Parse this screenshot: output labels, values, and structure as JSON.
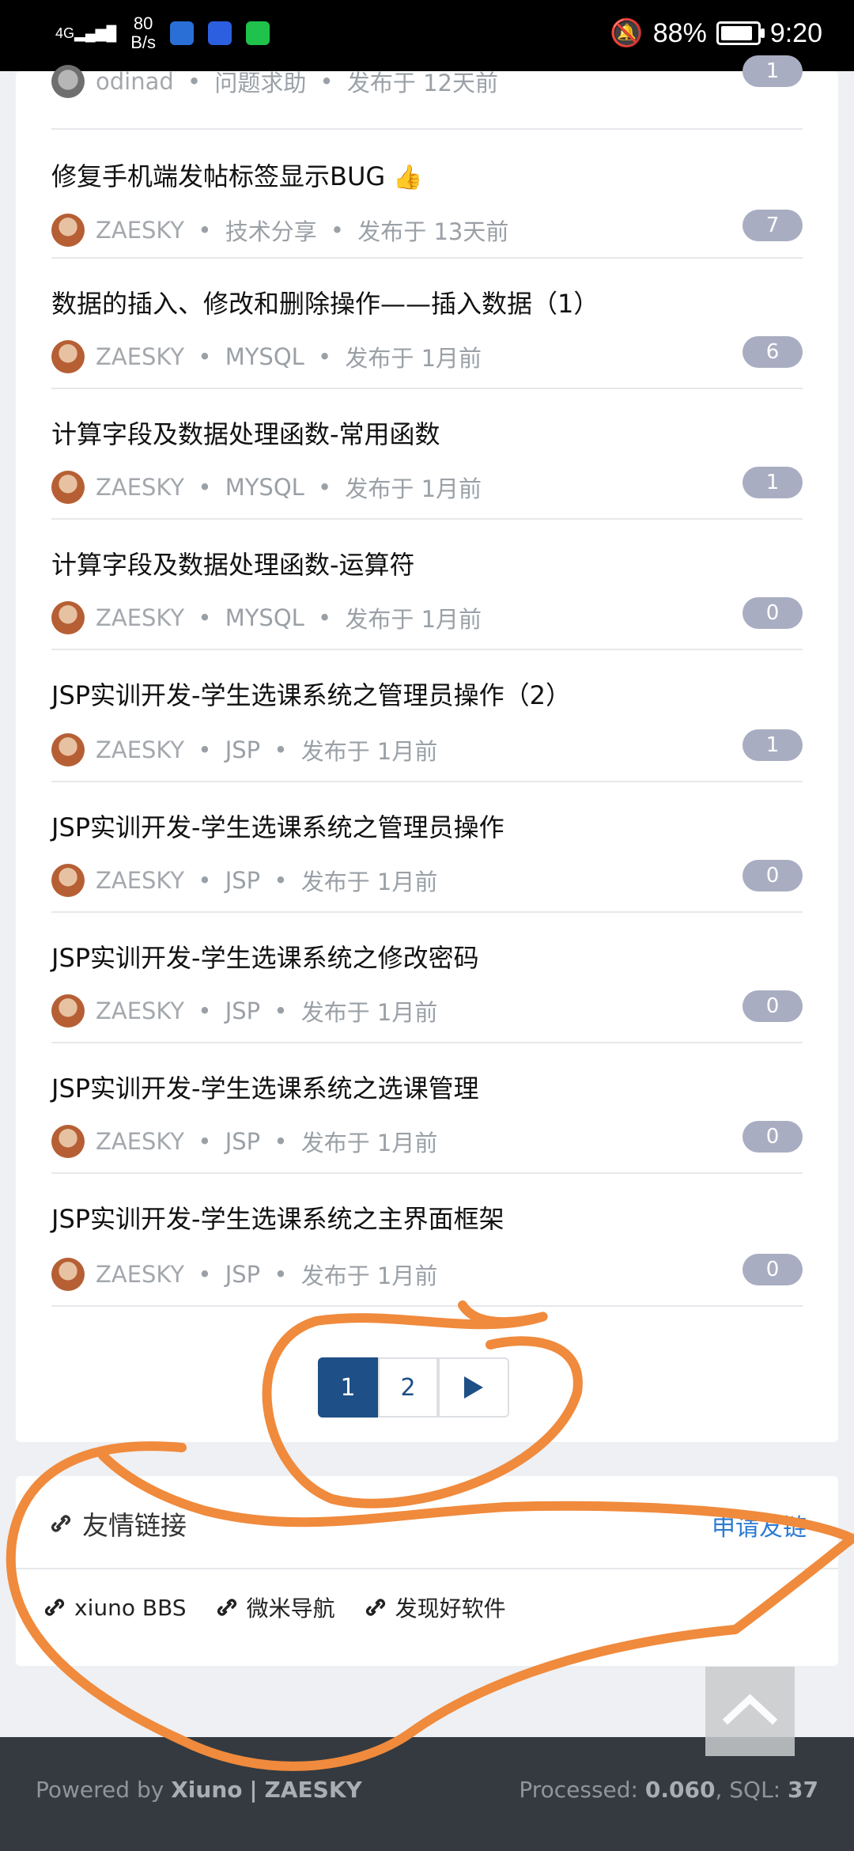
{
  "status_bar": {
    "network": "4G",
    "speed_value": "80",
    "speed_unit": "B/s",
    "battery": "88%",
    "battery_level": 0.88,
    "time": "9:20"
  },
  "threads": [
    {
      "title": "",
      "author": "odinad",
      "category": "问题求助",
      "posted": "发布于 12天前",
      "count": "1",
      "avatar": "grey"
    },
    {
      "title": "修复手机端发帖标签显示BUG",
      "author": "ZAESKY",
      "category": "技术分享",
      "posted": "发布于 13天前",
      "count": "7",
      "avatar": "default"
    },
    {
      "title": "数据的插入、修改和删除操作——插入数据（1）",
      "author": "ZAESKY",
      "category": "MYSQL",
      "posted": "发布于 1月前",
      "count": "6",
      "avatar": "default"
    },
    {
      "title": "计算字段及数据处理函数-常用函数",
      "author": "ZAESKY",
      "category": "MYSQL",
      "posted": "发布于 1月前",
      "count": "1",
      "avatar": "default"
    },
    {
      "title": "计算字段及数据处理函数-运算符",
      "author": "ZAESKY",
      "category": "MYSQL",
      "posted": "发布于 1月前",
      "count": "0",
      "avatar": "default"
    },
    {
      "title": "JSP实训开发-学生选课系统之管理员操作（2）",
      "author": "ZAESKY",
      "category": "JSP",
      "posted": "发布于 1月前",
      "count": "1",
      "avatar": "default"
    },
    {
      "title": "JSP实训开发-学生选课系统之管理员操作",
      "author": "ZAESKY",
      "category": "JSP",
      "posted": "发布于 1月前",
      "count": "0",
      "avatar": "default"
    },
    {
      "title": "JSP实训开发-学生选课系统之修改密码",
      "author": "ZAESKY",
      "category": "JSP",
      "posted": "发布于 1月前",
      "count": "0",
      "avatar": "default"
    },
    {
      "title": "JSP实训开发-学生选课系统之选课管理",
      "author": "ZAESKY",
      "category": "JSP",
      "posted": "发布于 1月前",
      "count": "0",
      "avatar": "default"
    },
    {
      "title": "JSP实训开发-学生选课系统之主界面框架",
      "author": "ZAESKY",
      "category": "JSP",
      "posted": "发布于 1月前",
      "count": "0",
      "avatar": "default"
    }
  ],
  "pagination": {
    "pages": [
      "1",
      "2"
    ],
    "current": "1",
    "next_icon": "next-arrow-icon"
  },
  "friend_links": {
    "title": "友情链接",
    "apply": "申请友链",
    "items": [
      "xiuno BBS",
      "微米导航",
      "发现好软件"
    ]
  },
  "footer": {
    "powered_prefix": "Powered by",
    "brand": "Xiuno",
    "separator": "|",
    "site": "ZAESKY",
    "processed_label": "Processed:",
    "processed_value": "0.060",
    "sql_label": ", SQL:",
    "sql_value": "37"
  },
  "colors": {
    "primary": "#1e4f86",
    "badge": "#a9adc1",
    "link": "#2d7bd1",
    "annotation": "#f08a3c",
    "footer_bg": "#343a40"
  }
}
